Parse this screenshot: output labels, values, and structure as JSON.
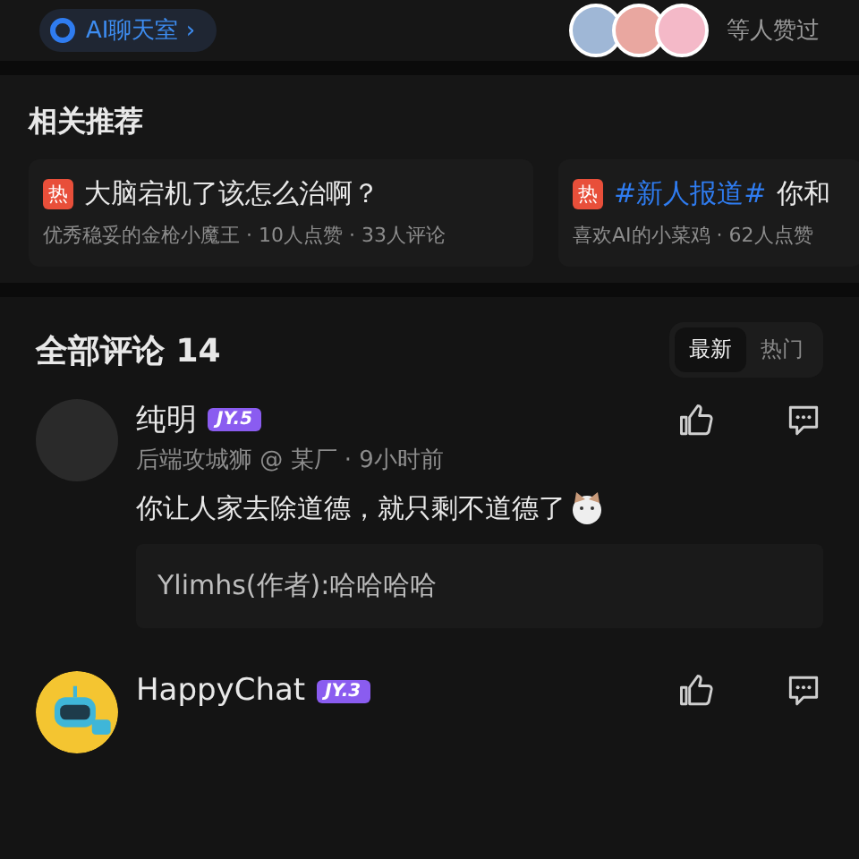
{
  "top_bar": {
    "topic_label": "AI聊天室 ›",
    "likes_text": "等人赞过"
  },
  "related": {
    "title": "相关推荐",
    "items": [
      {
        "badge": "热",
        "title": "大脑宕机了该怎么治啊？",
        "meta": "优秀稳妥的金枪小魔王 · 10人点赞 · 33人评论"
      },
      {
        "badge": "热",
        "tag": "#新人报道#",
        "title": "你和",
        "meta": "喜欢AI的小菜鸡 · 62人点赞"
      }
    ]
  },
  "comments": {
    "title": "全部评论 14",
    "sort_tabs": [
      {
        "label": "最新",
        "selected": true
      },
      {
        "label": "热门",
        "selected": false
      }
    ],
    "items": [
      {
        "name": "纯明",
        "level": "JY.5",
        "meta": "后端攻城狮 @ 某厂 · 9小时前",
        "text": "你让人家去除道德，就只剩不道德了",
        "reply": "Ylimhs(作者):哈哈哈哈",
        "kind": "image_avatar"
      },
      {
        "name": "HappyChat",
        "level": "JY.3",
        "kind": "robot_avatar"
      }
    ]
  }
}
